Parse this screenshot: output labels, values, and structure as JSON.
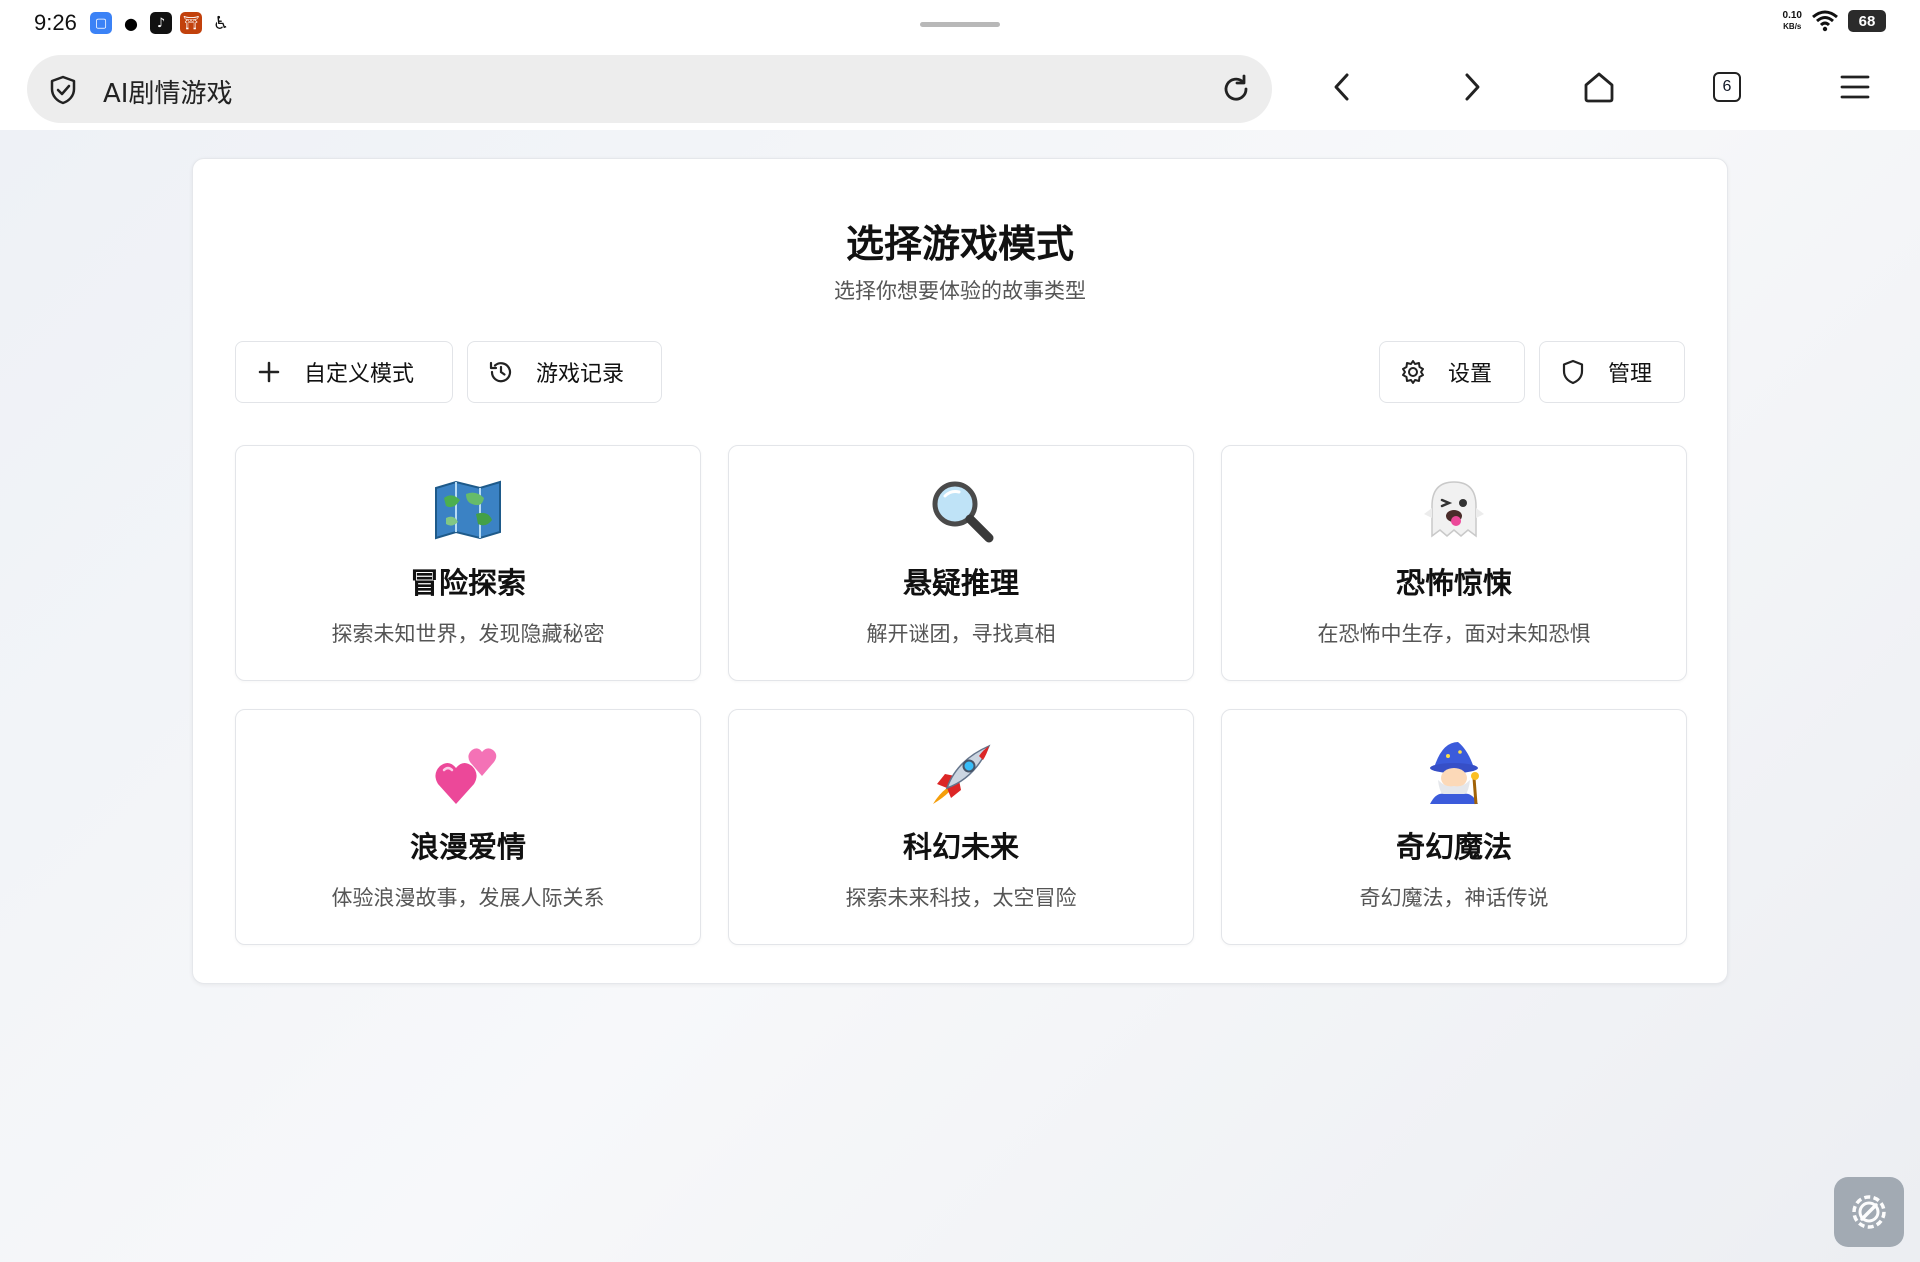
{
  "status_bar": {
    "time": "9:26",
    "net_speed_value": "0.10",
    "net_speed_unit": "KB/s",
    "battery": "68"
  },
  "browser": {
    "address_text": "AI剧情游戏",
    "tabs_count": "6"
  },
  "page": {
    "title": "选择游戏模式",
    "subtitle": "选择你想要体验的故事类型",
    "toolbar": {
      "custom_mode": "自定义模式",
      "history": "游戏记录",
      "settings": "设置",
      "admin": "管理"
    },
    "modes": [
      {
        "title": "冒险探索",
        "desc": "探索未知世界，发现隐藏秘密",
        "icon": "world-map-icon"
      },
      {
        "title": "悬疑推理",
        "desc": "解开谜团，寻找真相",
        "icon": "magnifier-icon"
      },
      {
        "title": "恐怖惊悚",
        "desc": "在恐怖中生存，面对未知恐惧",
        "icon": "ghost-icon"
      },
      {
        "title": "浪漫爱情",
        "desc": "体验浪漫故事，发展人际关系",
        "icon": "two-hearts-icon"
      },
      {
        "title": "科幻未来",
        "desc": "探索未来科技，太空冒险",
        "icon": "rocket-icon"
      },
      {
        "title": "奇幻魔法",
        "desc": "奇幻魔法，神话传说",
        "icon": "wizard-icon"
      }
    ]
  }
}
